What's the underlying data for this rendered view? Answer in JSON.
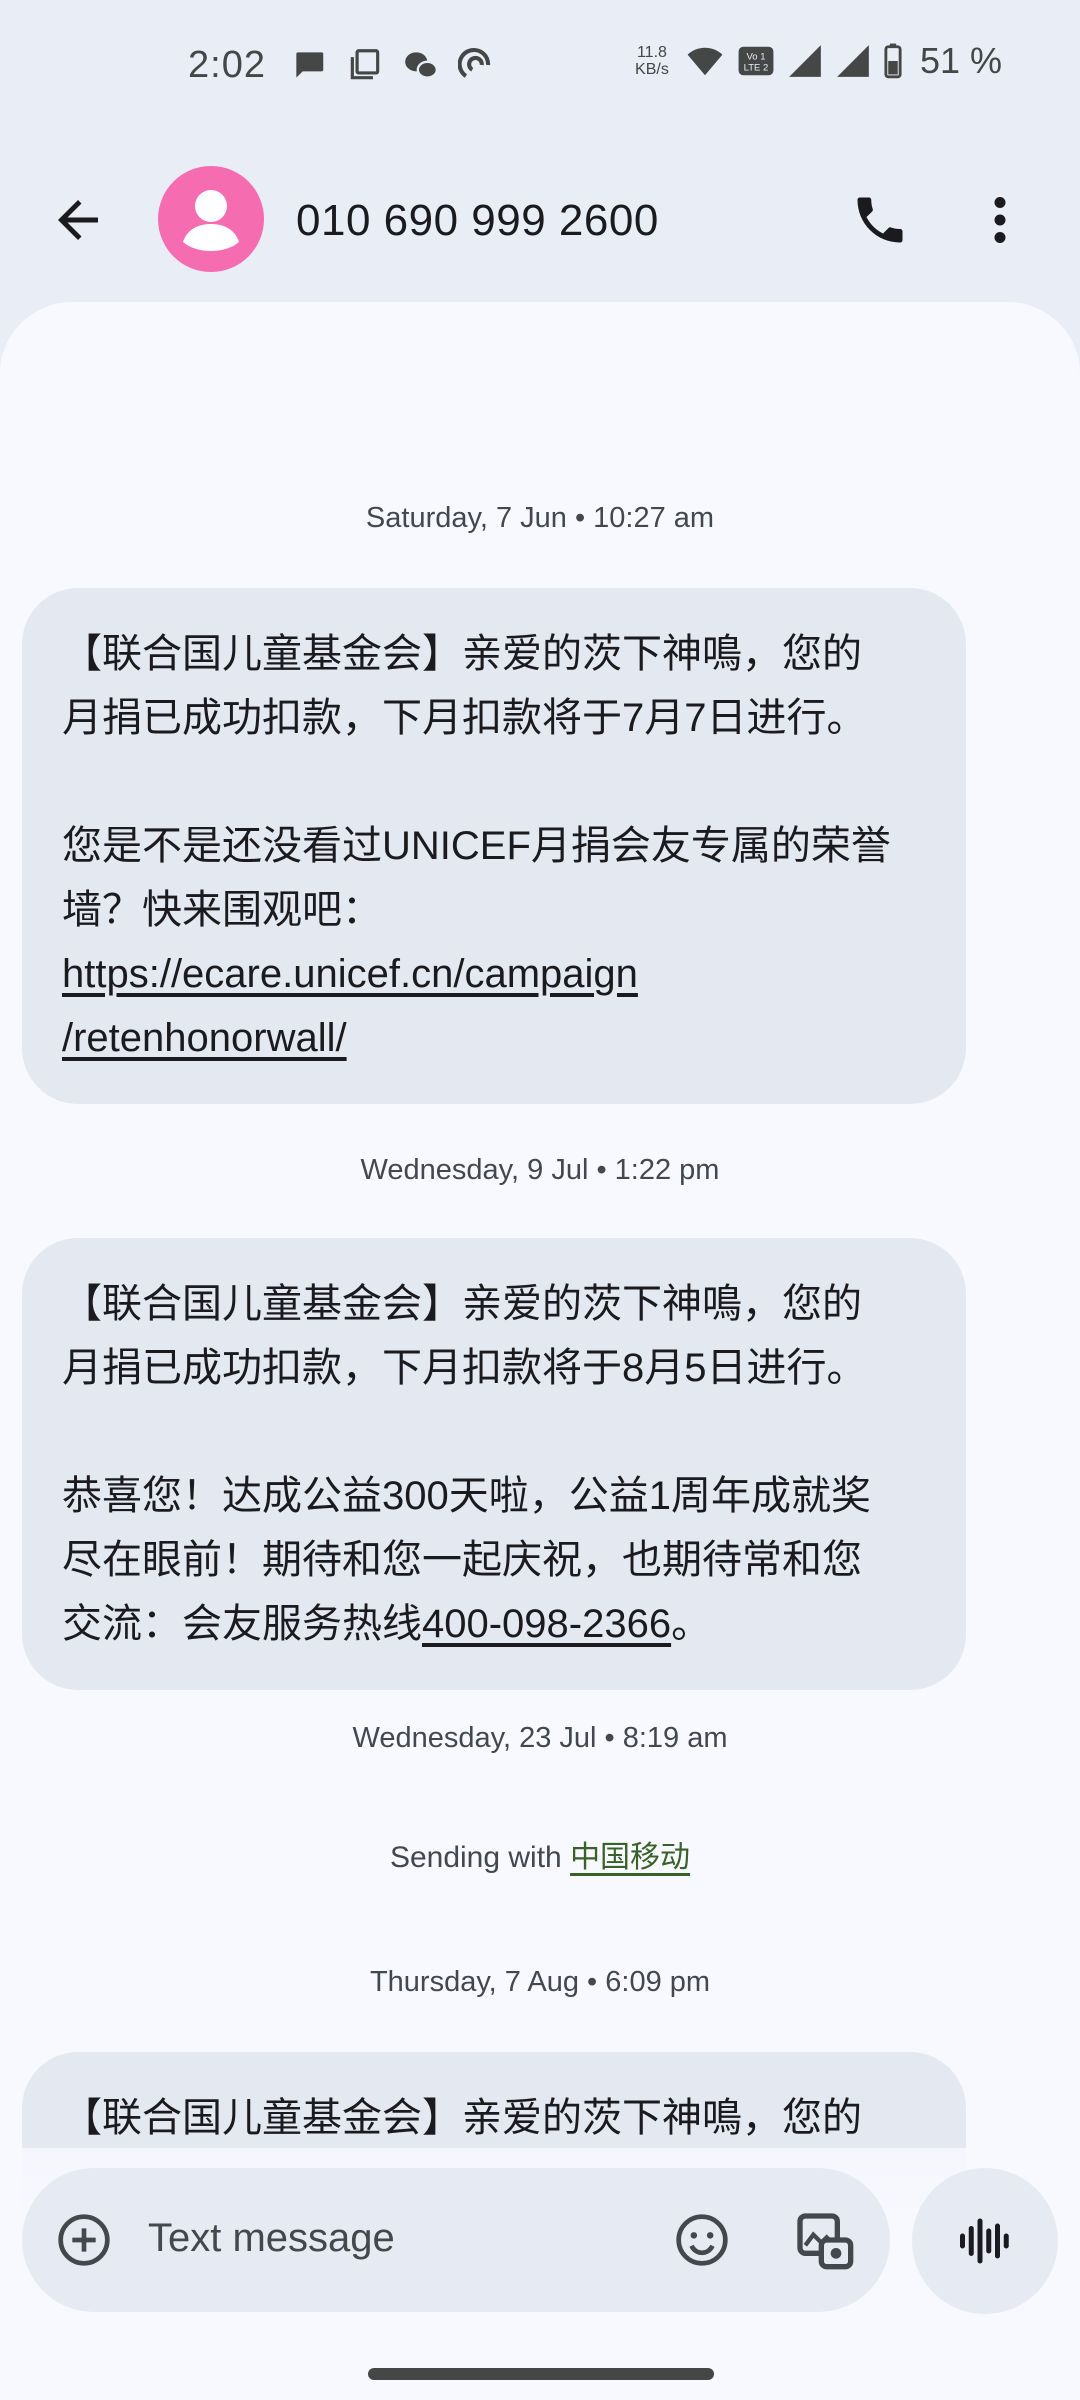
{
  "status_bar": {
    "time": "2:02",
    "net_speed_value": "11.8",
    "net_speed_unit": "KB/s",
    "battery": "51 %",
    "icons": [
      "chat-bubble-icon",
      "copy-icon",
      "wechat-icon",
      "sync-icon",
      "wifi-icon",
      "volte-icon",
      "signal-icon",
      "signal-icon",
      "battery-icon"
    ]
  },
  "header": {
    "contact": "010 690 999 2600",
    "icons": [
      "back-arrow-icon",
      "person-icon",
      "phone-icon",
      "more-vert-icon"
    ]
  },
  "conversation": {
    "timestamps": [
      "Saturday, 7 Jun • 10:27 am",
      "Wednesday, 9 Jul • 1:22 pm",
      "Wednesday, 23 Jul • 8:19 am",
      "Thursday, 7 Aug • 6:09 pm"
    ],
    "msg1": {
      "line1": "【联合国儿童基金会】亲爱的茨下神鳴，您的",
      "line2": "月捐已成功扣款，下月扣款将于7月7日进行。",
      "line3": "您是不是还没看过UNICEF月捐会友专属的荣誉",
      "line4": "墙？快来围观吧：",
      "link1": "https://ecare.unicef.cn/campaign",
      "link2": "/retenhonorwall/"
    },
    "msg2": {
      "line1": "【联合国儿童基金会】亲爱的茨下神鳴，您的",
      "line2": "月捐已成功扣款，下月扣款将于8月5日进行。",
      "line3": "恭喜您！达成公益300天啦，公益1周年成就奖",
      "line4": "尽在眼前！期待和您一起庆祝，也期待常和您",
      "line5_prefix": "交流：会友服务热线",
      "hotline": "400-098-2366",
      "line5_suffix": "。"
    },
    "sending_prefix": "Sending with ",
    "carrier": "中国移动",
    "msg3": {
      "line1": "【联合国儿童基金会】亲爱的茨下神鳴，您的"
    }
  },
  "compose": {
    "placeholder": "Text message",
    "icons": [
      "add-circle-icon",
      "emoji-icon",
      "gallery-icon",
      "voice-icon"
    ]
  },
  "colors": {
    "avatar": "#f56cb1",
    "bubble": "#e4e8f1",
    "background": "#f8f9ff",
    "carrier_link": "#39612a"
  }
}
